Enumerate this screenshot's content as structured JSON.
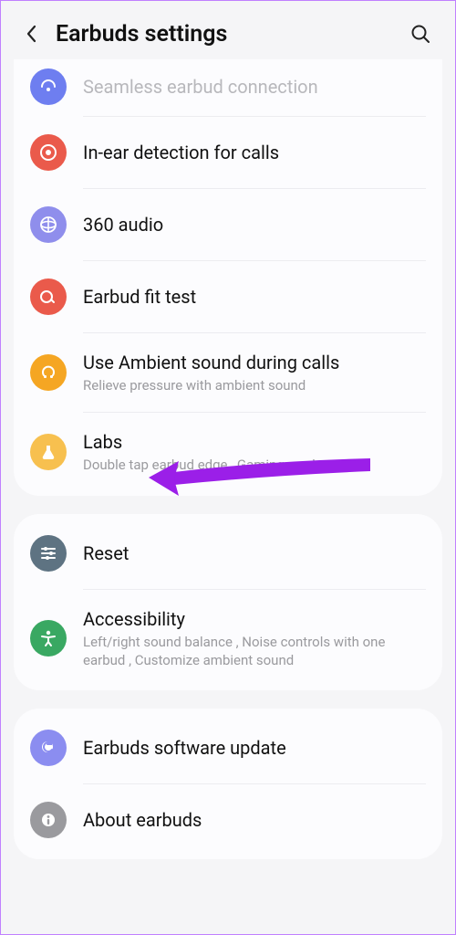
{
  "header": {
    "title": "Earbuds settings"
  },
  "sections": [
    {
      "items": [
        {
          "title": "Seamless earbud connection",
          "cut": true
        },
        {
          "title": "In-ear detection for calls"
        },
        {
          "title": "360 audio"
        },
        {
          "title": "Earbud fit test"
        },
        {
          "title": "Use Ambient sound during calls",
          "subtitle": "Relieve pressure with ambient sound"
        },
        {
          "title": "Labs",
          "subtitle": "Double tap earbud edge , Gaming mode"
        }
      ]
    },
    {
      "items": [
        {
          "title": "Reset"
        },
        {
          "title": "Accessibility",
          "subtitle": "Left/right sound balance , Noise controls with one earbud , Customize ambient sound"
        }
      ]
    },
    {
      "items": [
        {
          "title": "Earbuds software update"
        },
        {
          "title": "About earbuds"
        }
      ]
    }
  ],
  "colors": {
    "blue": "#6e7ef0",
    "red": "#ea5a4b",
    "purple": "#8f8eec",
    "orange": "#f5a623",
    "amber": "#f7c04f",
    "slate": "#5e7382",
    "green": "#39a862",
    "lavender": "#8b8df0",
    "grey": "#9a9a9e"
  }
}
